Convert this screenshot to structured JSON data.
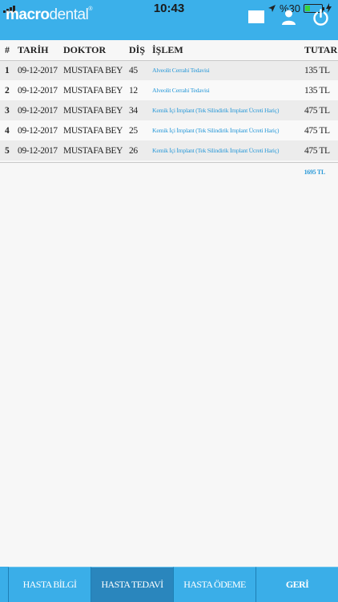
{
  "status": {
    "time": "10:43",
    "battery_text": "%30",
    "battery_level": 0.3
  },
  "app": {
    "logo_bold": "macro",
    "logo_light": "dental",
    "logo_mark": "®"
  },
  "table": {
    "headers": {
      "num": "#",
      "date": "TARİH",
      "doctor": "DOKTOR",
      "tooth": "DİŞ",
      "procedure": "İŞLEM",
      "amount": "TUTAR"
    },
    "rows": [
      {
        "num": "1",
        "date": "09-12-2017",
        "doctor": "MUSTAFA BEY",
        "tooth": "45",
        "procedure": "Alveolit Cerrahi Tedavisi",
        "amount": "135 TL"
      },
      {
        "num": "2",
        "date": "09-12-2017",
        "doctor": "MUSTAFA BEY",
        "tooth": "12",
        "procedure": "Alveolit Cerrahi Tedavisi",
        "amount": "135 TL"
      },
      {
        "num": "3",
        "date": "09-12-2017",
        "doctor": "MUSTAFA BEY",
        "tooth": "34",
        "procedure": "Kemik İçi İmplant (Tek Silindirik İmplant Ücreti Hariç)",
        "amount": "475 TL"
      },
      {
        "num": "4",
        "date": "09-12-2017",
        "doctor": "MUSTAFA BEY",
        "tooth": "25",
        "procedure": "Kemik İçi İmplant (Tek Silindirik İmplant Ücreti Hariç)",
        "amount": "475 TL"
      },
      {
        "num": "5",
        "date": "09-12-2017",
        "doctor": "MUSTAFA BEY",
        "tooth": "26",
        "procedure": "Kemik İçi İmplant (Tek Silindirik İmplant Ücreti Hariç)",
        "amount": "475 TL"
      }
    ],
    "total": "1695 TL"
  },
  "footer": {
    "info": "HASTA BİLGİ",
    "treatment": "HASTA TEDAVİ",
    "payment": "HASTA ÖDEME",
    "back": "GERİ"
  },
  "colors": {
    "header": "#3bb0ea",
    "accent": "#2c9ad8",
    "footer_active": "#2a86bd"
  }
}
